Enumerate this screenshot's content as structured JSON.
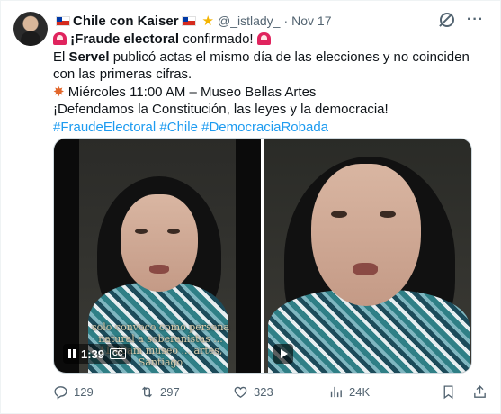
{
  "author": {
    "name": "Chile con Kaiser",
    "handle": "@_istlady_",
    "separator": "·",
    "date": "Nov 17"
  },
  "tweet": {
    "line1_bold": "¡Fraude electoral",
    "line1_rest": " confirmado!",
    "line2_pre": "El ",
    "line2_bold": "Servel",
    "line2_rest": " publicó actas el mismo día de las elecciones y no coinciden con las primeras cifras.",
    "line3": "Miércoles 11:00 AM – Museo Bellas Artes",
    "line4": "¡Defendamos la Constitución, las leyes y la democracia!",
    "hashtags": [
      "#FraudeElectoral",
      "#Chile",
      "#DemocraciaRobada"
    ]
  },
  "media": {
    "video1": {
      "time": "1:39",
      "cc": "CC",
      "subtitle": "solo convoco como persona natural a soberanistas ... 11:00am museo ... artes, Santiago"
    }
  },
  "actions": {
    "replies": "129",
    "reposts": "297",
    "likes": "323",
    "views": "24K"
  },
  "colors": {
    "accent": "#1d9bf0",
    "muted": "#536471",
    "text": "#0f1419"
  }
}
